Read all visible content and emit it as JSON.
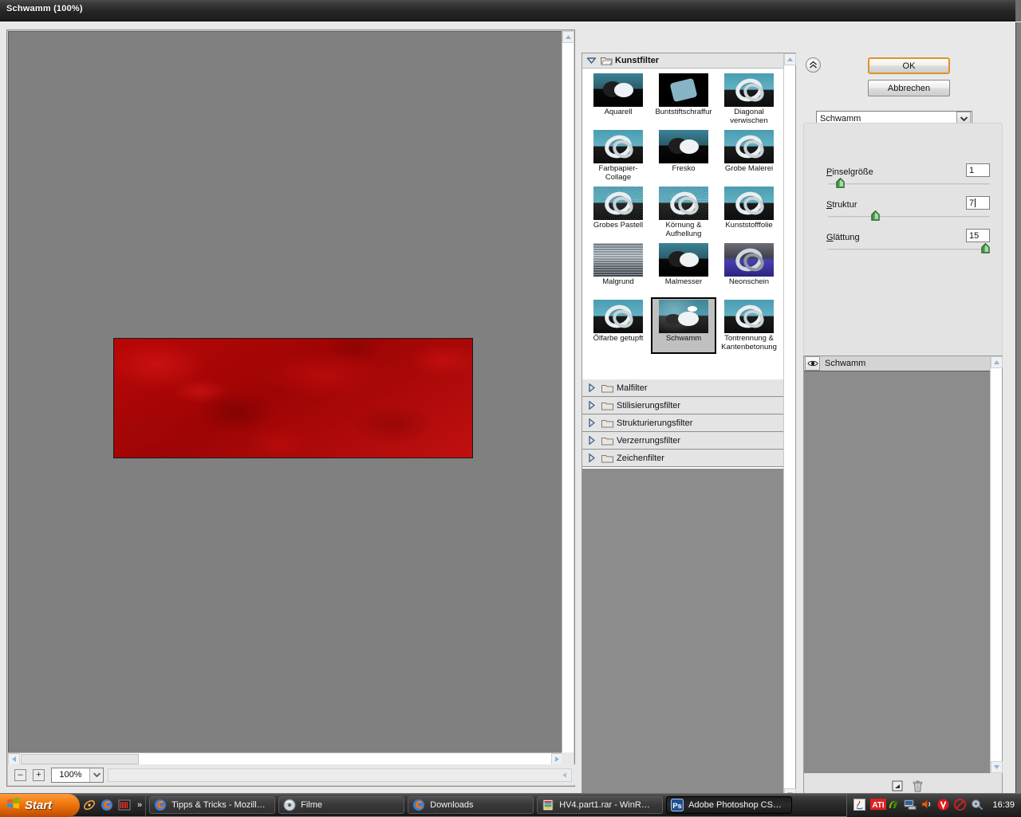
{
  "window": {
    "title": "Schwamm (100%)"
  },
  "preview": {
    "zoom_value": "100%",
    "zoom_out_label": "–",
    "zoom_in_label": "+",
    "image_color": "#ab0505"
  },
  "gallery": {
    "expanded_category": {
      "label": "Kunstfilter",
      "twisty_icon": "triangle-down-icon",
      "folder_icon": "folder-open-icon"
    },
    "filters": [
      {
        "label": "Aquarell",
        "thumb_style": "th-dark",
        "selected": false
      },
      {
        "label": "Buntstiftschraffur",
        "thumb_style": "th-black",
        "selected": false
      },
      {
        "label": "Diagonal verwischen",
        "thumb_style": "",
        "selected": false
      },
      {
        "label": "Farbpapier-Collage",
        "thumb_style": "",
        "selected": false
      },
      {
        "label": "Fresko",
        "thumb_style": "th-dark",
        "selected": false
      },
      {
        "label": "Grobe Malerei",
        "thumb_style": "",
        "selected": false
      },
      {
        "label": "Grobes Pastell",
        "thumb_style": "th-grain",
        "selected": false
      },
      {
        "label": "Körnung & Aufhellung",
        "thumb_style": "th-grain",
        "selected": false
      },
      {
        "label": "Kunststofffolie",
        "thumb_style": "",
        "selected": false
      },
      {
        "label": "Malgrund",
        "thumb_style": "th-water",
        "selected": false
      },
      {
        "label": "Malmesser",
        "thumb_style": "th-dark",
        "selected": false
      },
      {
        "label": "Neonschein",
        "thumb_style": "th-neon",
        "selected": false
      },
      {
        "label": "Ölfarbe getupft",
        "thumb_style": "",
        "selected": false
      },
      {
        "label": "Schwamm",
        "thumb_style": "th-sponge",
        "selected": true
      },
      {
        "label": "Tontrennung & Kantenbetonung",
        "thumb_style": "",
        "selected": false
      }
    ],
    "collapsed_categories": [
      {
        "label": "Malfilter"
      },
      {
        "label": "Stilisierungsfilter"
      },
      {
        "label": "Strukturierungsfilter"
      },
      {
        "label": "Verzerrungsfilter"
      },
      {
        "label": "Zeichenfilter"
      }
    ]
  },
  "settings": {
    "collapse_icon": "double-chevron-up-icon",
    "ok_label": "OK",
    "cancel_label": "Abbrechen",
    "ok_accent": "#e0922a",
    "filter_select_value": "Schwamm",
    "params": [
      {
        "label": "Pinselgröße",
        "accesskey": "P",
        "rest": "inselgröße",
        "value": "1",
        "percent": 5,
        "focused": false
      },
      {
        "label": "Struktur",
        "accesskey": "S",
        "rest": "truktur",
        "value": "7",
        "percent": 28,
        "focused": true
      },
      {
        "label": "Glättung",
        "accesskey": "G",
        "rest": "lättung",
        "value": "15",
        "percent": 100,
        "focused": false
      }
    ]
  },
  "layers": {
    "eye_icon": "eye-icon",
    "entry_label": "Schwamm",
    "new_layer_icon": "new-effect-layer-icon",
    "delete_layer_icon": "trash-icon"
  },
  "taskbar": {
    "start_label": "Start",
    "start_icon": "windows-flag-icon",
    "quicklaunch": [
      {
        "icon": "media-player-icon"
      },
      {
        "icon": "firefox-icon"
      },
      {
        "icon": "winamp-icon"
      }
    ],
    "quicklaunch_overflow": "»",
    "tasks": [
      {
        "label": "Tipps & Tricks - Mozill…",
        "icon": "firefox-icon",
        "active": false
      },
      {
        "label": "Filme",
        "icon": "disc-icon",
        "active": false
      },
      {
        "label": "Downloads",
        "icon": "firefox-icon",
        "active": false
      },
      {
        "label": "HV4.part1.rar - WinR…",
        "icon": "winrar-icon",
        "active": false
      },
      {
        "label": "Adobe Photoshop CS…",
        "icon": "photoshop-icon",
        "active": true
      }
    ],
    "tray_icons": [
      {
        "icon": "java-icon"
      },
      {
        "icon": "ati-catalyst-icon"
      },
      {
        "icon": "nvidia-icon"
      },
      {
        "icon": "network-icon"
      },
      {
        "icon": "volume-icon"
      },
      {
        "icon": "avira-icon"
      },
      {
        "icon": "safely-remove-icon"
      },
      {
        "icon": "sound-device-icon"
      }
    ],
    "clock": "16:39"
  }
}
